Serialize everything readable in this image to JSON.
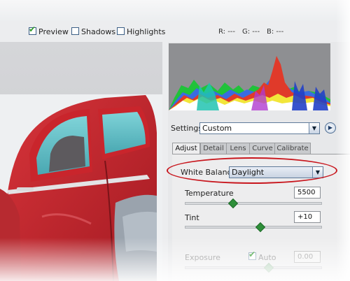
{
  "toolbar": {
    "preview_label": "Preview",
    "preview_checked": true,
    "shadows_label": "Shadows",
    "shadows_checked": false,
    "highlights_label": "Highlights",
    "highlights_checked": false,
    "r_label": "R: ---",
    "g_label": "G: ---",
    "b_label": "B: ---"
  },
  "settings": {
    "label": "Settings:",
    "value": "Custom"
  },
  "tabs": [
    {
      "label": "Adjust",
      "active": true
    },
    {
      "label": "Detail",
      "active": false
    },
    {
      "label": "Lens",
      "active": false
    },
    {
      "label": "Curve",
      "active": false
    },
    {
      "label": "Calibrate",
      "active": false
    }
  ],
  "white_balance": {
    "label": "White Balance:",
    "value": "Daylight"
  },
  "temperature": {
    "label": "Temperature",
    "value": "5500",
    "slider_position": 0.34
  },
  "tint": {
    "label": "Tint",
    "value": "+10",
    "slider_position": 0.54
  },
  "exposure": {
    "label": "Exposure",
    "auto_label": "Auto",
    "auto_checked": true,
    "value": "0.00",
    "slider_position": 0.6
  },
  "colors": {
    "highlight_oval": "#c8161d",
    "checkbox_tick": "#2f9a2a",
    "slider_thumb": "#2f8f3a"
  }
}
